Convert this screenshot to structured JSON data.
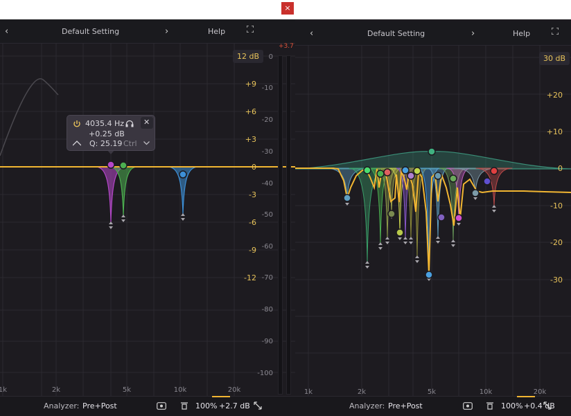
{
  "window": {
    "close_label": "×"
  },
  "left": {
    "header": {
      "prev": "‹",
      "preset": "Default Setting",
      "next": "›",
      "help": "Help"
    },
    "db_range_badge": "12 dB",
    "meter_peak": "+3.7",
    "gain_labels": [
      "+9",
      "+6",
      "+3",
      "0",
      "-3",
      "-6",
      "-9",
      "-12"
    ],
    "spectrum_labels": [
      "0",
      "-10",
      "-20",
      "-30",
      "-40",
      "-50",
      "-60",
      "-70",
      "-80",
      "-90",
      "-100"
    ],
    "freq_labels": [
      "1k",
      "2k",
      "5k",
      "10k",
      "20k"
    ],
    "tooltip": {
      "freq": "4035.4 Hz",
      "gain": "+0.25 dB",
      "q": "Q: 25.19",
      "ctrl": "Ctrl",
      "close": "✕"
    },
    "footer": {
      "analyzer_label": "Analyzer:",
      "analyzer_value": "Pre+Post",
      "zoom": "100%",
      "gain": "+2.7 dB"
    }
  },
  "right": {
    "header": {
      "prev": "‹",
      "preset": "Default Setting",
      "next": "›",
      "help": "Help"
    },
    "db_range_badge": "30 dB",
    "gain_labels": [
      "+20",
      "+10",
      "0",
      "-10",
      "-20",
      "-30"
    ],
    "freq_labels": [
      "1k",
      "2k",
      "5k",
      "10k",
      "20k"
    ],
    "footer": {
      "analyzer_label": "Analyzer:",
      "analyzer_value": "Pre+Post",
      "zoom": "100%",
      "gain": "+0.4 dB"
    }
  },
  "colors": {
    "curve": "#f2b632",
    "gain_label": "#e8c35a",
    "spectrum_label": "#8a8890",
    "accent_red": "#e0533a"
  }
}
